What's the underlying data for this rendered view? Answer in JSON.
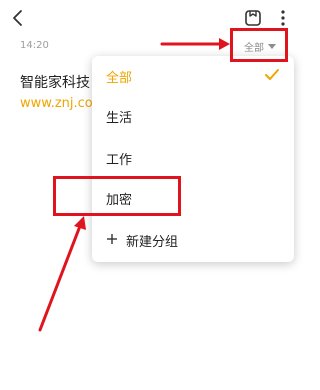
{
  "header": {
    "back_icon": "chevron-left-icon",
    "share_icon": "share-icon",
    "more_icon": "more-vertical-icon"
  },
  "note": {
    "time": "14:20",
    "title": "智能家科技",
    "url": "www.znj.cor"
  },
  "filter": {
    "label": "全部",
    "icon": "caret-down-icon"
  },
  "menu": {
    "items": [
      {
        "label": "全部",
        "selected": true
      },
      {
        "label": "生活",
        "selected": false
      },
      {
        "label": "工作",
        "selected": false
      },
      {
        "label": "加密",
        "selected": false
      }
    ],
    "new_group_label": "新建分组"
  },
  "colors": {
    "accent": "#f0a500",
    "annotation": "#e0141e"
  }
}
